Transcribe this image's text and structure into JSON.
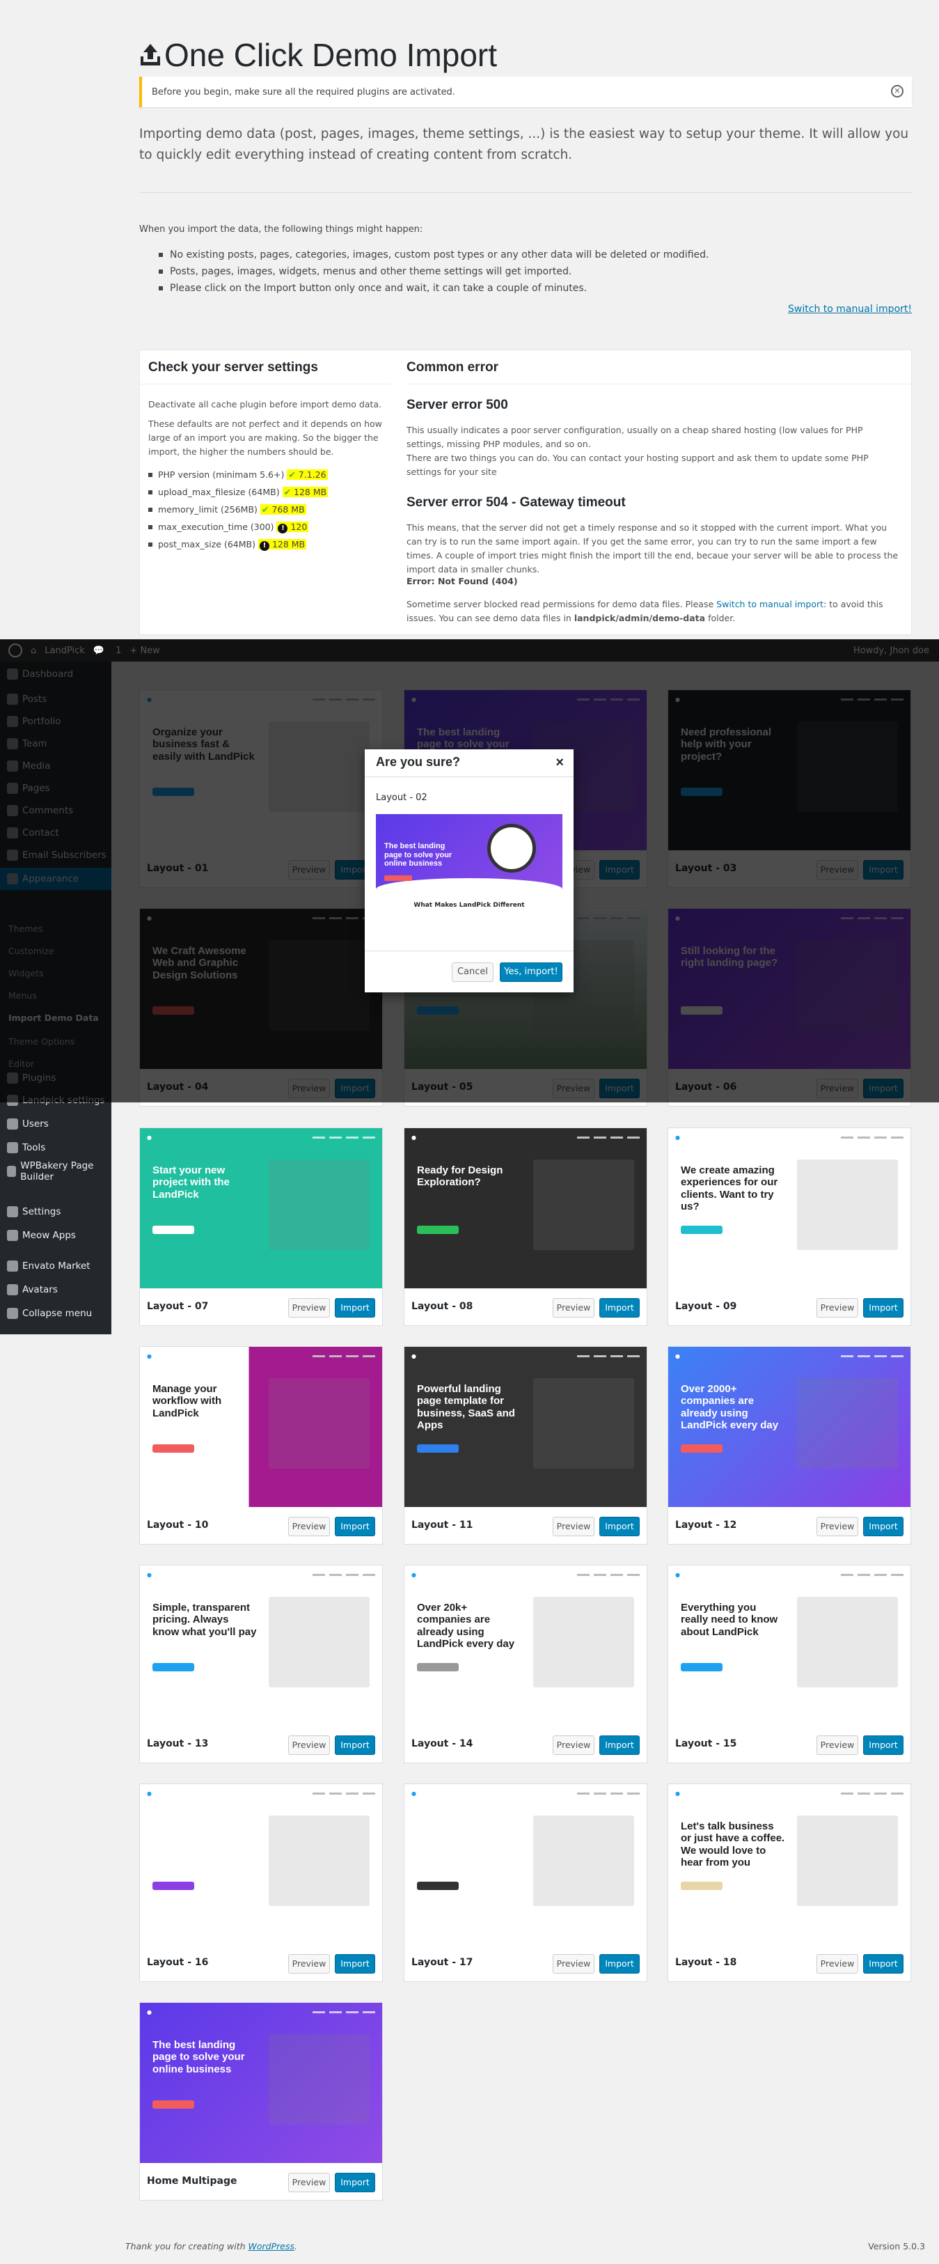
{
  "page": {
    "title": "One Click Demo Import",
    "notice": "Before you begin, make sure all the required plugins are activated.",
    "intro": "Importing demo data (post, pages, images, theme settings, ...) is the easiest way to setup your theme. It will allow you to quickly edit everything instead of creating content from scratch.",
    "note": "When you import the data, the following things might happen:",
    "bullets": [
      "No existing posts, pages, categories, images, custom post types or any other data will be deleted or modified.",
      "Posts, pages, images, widgets, menus and other theme settings will get imported.",
      "Please click on the Import button only once and wait, it can take a couple of minutes."
    ],
    "manual_link": "Switch to manual import!"
  },
  "server": {
    "title": "Check your server settings",
    "p1": "Deactivate all cache plugin before import demo data.",
    "p2": "These defaults are not perfect and it depends on how large of an import you are making. So the bigger the import, the higher the numbers should be.",
    "items": [
      {
        "label": "PHP version (minimam 5.6+)",
        "value": "7.1.26",
        "status": "ok"
      },
      {
        "label": "upload_max_filesize (64MB)",
        "value": "128 MB",
        "status": "ok"
      },
      {
        "label": "memory_limit (256MB)",
        "value": "768 MB",
        "status": "ok"
      },
      {
        "label": "max_execution_time (300)",
        "value": "120",
        "status": "warn"
      },
      {
        "label": "post_max_size (64MB)",
        "value": "128 MB",
        "status": "warn"
      }
    ]
  },
  "errors": {
    "title": "Common error",
    "e500_title": "Server error 500",
    "e500_p1": "This usually indicates a poor server configuration, usually on a cheap shared hosting (low values for PHP settings, missing PHP modules, and so on.",
    "e500_p2": "There are two things you can do. You can contact your hosting support and ask them to update some PHP settings for your site",
    "e504_title": "Server error 504 - Gateway timeout",
    "e504_p": "This means, that the server did not get a timely response and so it stopped with the current import. What you can try is to run the same import again. If you get the same error, you can try to run the same import a few times. A couple of import tries might finish the import till the end, becaue your server will be able to process the import data in smaller chunks.",
    "e404_title": "Error: Not Found (404)",
    "e404_p_a": "Sometime server blocked read permissions for demo data files. Please ",
    "e404_link": "Switch to manual import",
    "e404_p_b": ": to avoid this issues. You can see demo data files in ",
    "e404_path": "landpick/admin/demo-data",
    "e404_p_c": " folder."
  },
  "adminbar": {
    "site": "LandPick",
    "comments": "1",
    "new": "+ New",
    "howdy": "Howdy, Jhon doe"
  },
  "sidebar": {
    "items": [
      {
        "label": "Dashboard"
      },
      {
        "label": "Posts"
      },
      {
        "label": "Portfolio"
      },
      {
        "label": "Team"
      },
      {
        "label": "Media"
      },
      {
        "label": "Pages"
      },
      {
        "label": "Comments"
      },
      {
        "label": "Contact"
      },
      {
        "label": "Email Subscribers"
      },
      {
        "label": "Appearance"
      },
      {
        "label": "Plugins"
      },
      {
        "label": "Landpick settings"
      },
      {
        "label": "Users"
      },
      {
        "label": "Tools"
      },
      {
        "label": "WPBakery Page Builder"
      },
      {
        "label": "Settings"
      },
      {
        "label": "Meow Apps"
      },
      {
        "label": "Envato Market"
      },
      {
        "label": "Avatars"
      },
      {
        "label": "Collapse menu"
      }
    ],
    "sub": [
      "Themes",
      "Customize",
      "Widgets",
      "Menus",
      "Import Demo Data",
      "Theme Options",
      "Editor"
    ]
  },
  "buttons": {
    "preview": "Preview",
    "import": "Import"
  },
  "layouts": [
    {
      "name": "Layout - 01",
      "headline": "Organize your business fast & easily with LandPick"
    },
    {
      "name": "Layout - 02",
      "headline": "The best landing page to solve your online business"
    },
    {
      "name": "Layout - 03",
      "headline": "Need professional help with your project?"
    },
    {
      "name": "Layout - 04",
      "headline": "We Craft Awesome Web and Graphic Design Solutions"
    },
    {
      "name": "Layout - 05",
      "headline": ""
    },
    {
      "name": "Layout - 06",
      "headline": "Still looking for the right landing page?"
    },
    {
      "name": "Layout - 07",
      "headline": "Start your new project with the LandPick"
    },
    {
      "name": "Layout - 08",
      "headline": "Ready for Design Exploration?"
    },
    {
      "name": "Layout - 09",
      "headline": "We create amazing experiences for our clients. Want to try us?"
    },
    {
      "name": "Layout - 10",
      "headline": "Manage your workflow with LandPick"
    },
    {
      "name": "Layout - 11",
      "headline": "Powerful landing page template for business, SaaS and Apps"
    },
    {
      "name": "Layout - 12",
      "headline": "Over 2000+ companies are already using LandPick every day"
    },
    {
      "name": "Layout - 13",
      "headline": "Simple, transparent pricing. Always know what you'll pay"
    },
    {
      "name": "Layout - 14",
      "headline": "Over 20k+ companies are already using LandPick every day"
    },
    {
      "name": "Layout - 15",
      "headline": "Everything you really need to know about LandPick"
    },
    {
      "name": "Layout - 16",
      "headline": ""
    },
    {
      "name": "Layout - 17",
      "headline": ""
    },
    {
      "name": "Layout - 18",
      "headline": "Let's talk business or just have a coffee. We would love to hear from you"
    },
    {
      "name": "Home Multipage",
      "headline": "The best landing page to solve your online business"
    }
  ],
  "modal": {
    "title": "Are you sure?",
    "layout": "Layout - 02",
    "headline": "The best landing page to solve your online business",
    "sub": "What Makes LandPick Different",
    "cancel": "Cancel",
    "confirm": "Yes, import!"
  },
  "footer": {
    "thanks": "Thank you for creating with ",
    "wp": "WordPress",
    "version": "Version 5.0.3"
  },
  "colors": {
    "accent": "#0085ba",
    "notice": "#ffb900",
    "purple": "#7b3fe4",
    "teal": "#1fbf9f"
  }
}
